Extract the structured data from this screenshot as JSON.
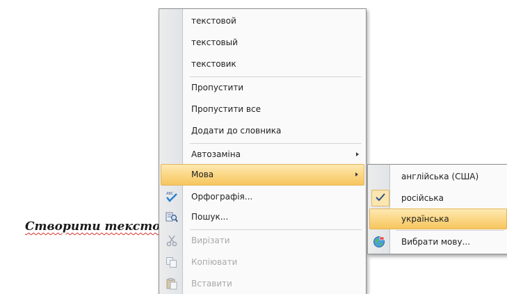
{
  "document": {
    "text": "Створити тексто"
  },
  "context_menu": {
    "suggestions": [
      "текстовой",
      "текстовый",
      "текстовик"
    ],
    "ignore_label": "Пропустити",
    "ignore_all_label": "Пропустити все",
    "add_to_dictionary_label": "Додати до словника",
    "autocorrect_label": "Автозаміна",
    "language_label": "Мова",
    "spelling_label": "Орфографія...",
    "lookup_label": "Пошук...",
    "cut_label": "Вирізати",
    "copy_label": "Копіювати",
    "paste_label": "Вставити"
  },
  "language_submenu": {
    "items": [
      "англійська (США)",
      "російська",
      "українська"
    ],
    "checked": "російська",
    "highlighted": "українська",
    "choose_language_label": "Вибрати мову..."
  },
  "icons": {
    "spelling": "spelling-check-icon",
    "lookup": "research-icon",
    "cut": "scissors-icon",
    "copy": "copy-icon",
    "paste": "paste-icon",
    "check": "checkmark-icon",
    "choose_language": "globe-icon"
  },
  "colors": {
    "highlight": "#f9cf72",
    "misspelling_underline": "#d9302c",
    "disabled_text": "#a9a9a9"
  }
}
